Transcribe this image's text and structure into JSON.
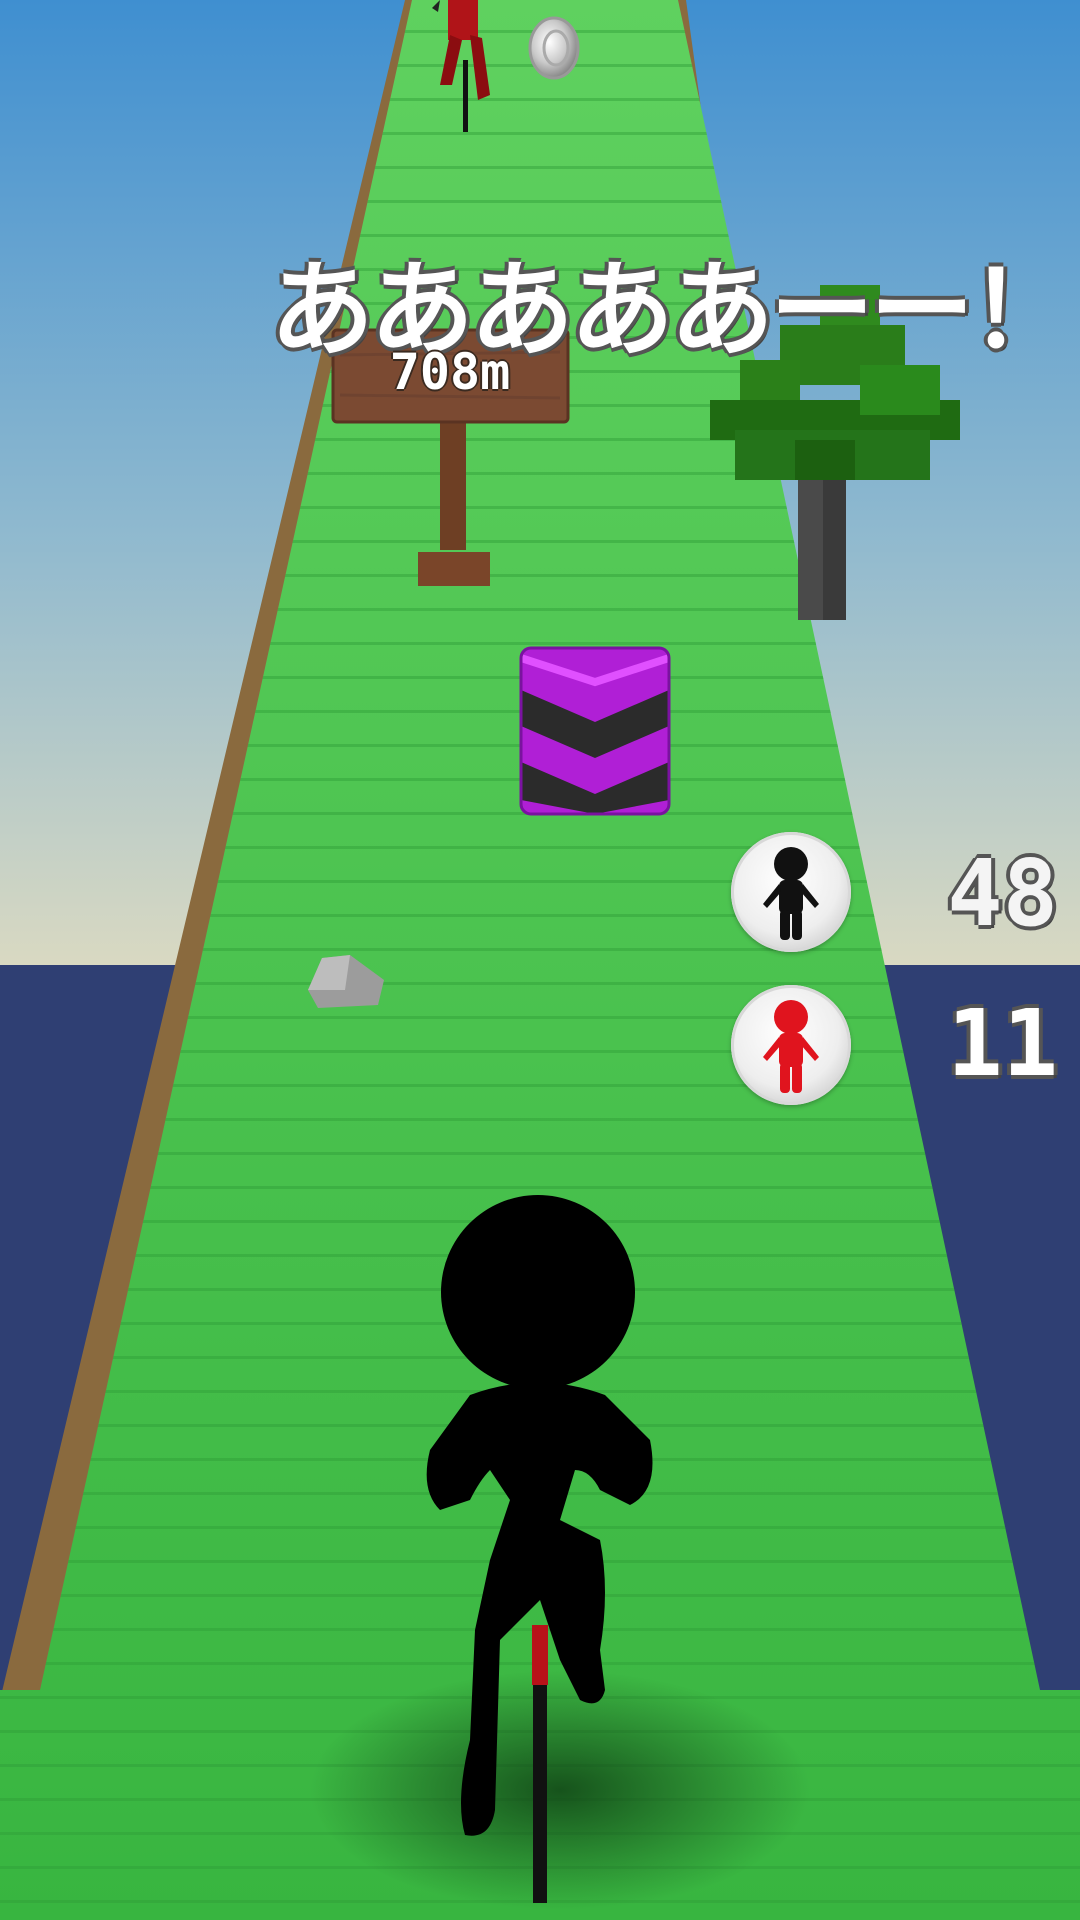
{
  "shout_text": "あああああーー！",
  "sign": {
    "distance": "708m"
  },
  "players": {
    "black": {
      "score": "48",
      "color": "#111111",
      "button_icon": "stickman-icon"
    },
    "red": {
      "score": "11",
      "color": "#e0141e",
      "button_icon": "stickman-icon"
    }
  },
  "colors": {
    "sky_top": "#3f8fd0",
    "sky_bottom": "#d8d8c4",
    "sea": "#2f3f73",
    "grass": "#3cc043",
    "obstacle": "#b01fd6"
  }
}
